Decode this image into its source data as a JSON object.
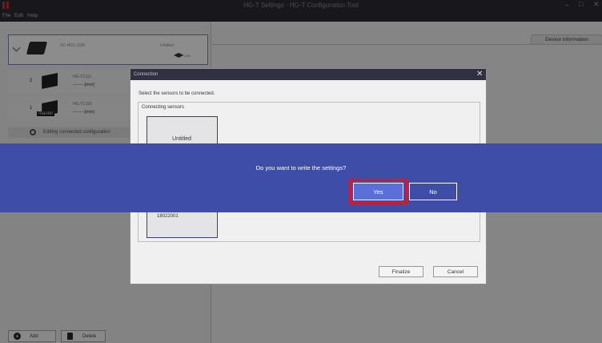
{
  "window": {
    "title": "HG-T Settings - HG-T Configuration Tool",
    "minimize": "–",
    "maximize": "□",
    "close": "✕"
  },
  "menu": [
    "File",
    "Edit",
    "Help"
  ],
  "left_panel": {
    "controller": {
      "model": "SC-HG1-USB",
      "name": "Untitled",
      "port": "USB"
    },
    "sensors": [
      {
        "number": "2",
        "model": "HG-TC111",
        "value": "--------[mm]",
        "badge": ""
      },
      {
        "number": "1",
        "model": "HG-TC101",
        "value": "--------[mm]",
        "badge": "master"
      }
    ],
    "editing_label": "Editing connected configuration",
    "buttons": {
      "add": "Add",
      "delete": "Delete"
    }
  },
  "right_panel": {
    "tab": "Device information"
  },
  "connection_dialog": {
    "title": "Connection",
    "instruction": "Select the sensors to be connected.",
    "group_label": "Connecting sensors",
    "card": {
      "title": "Untitled",
      "serial": "18022001"
    },
    "finalize": "Finalize",
    "cancel": "Cancel"
  },
  "confirm": {
    "message": "Do you want to write the settings?",
    "yes": "Yes",
    "no": "No"
  },
  "colors": {
    "band": "#3e4ea8",
    "highlight": "#d4182a",
    "titlebar": "#2b2b33"
  }
}
